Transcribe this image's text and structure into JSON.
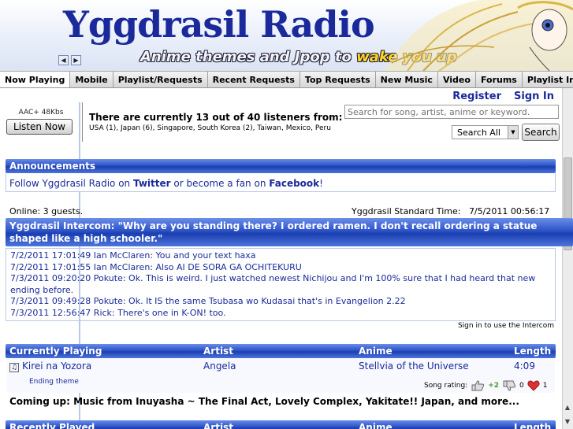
{
  "header": {
    "title": "Yggdrasil Radio",
    "tagline_part1": "Anime themes and Jpop to ",
    "tagline_highlight": "wake you up"
  },
  "tabs": [
    {
      "label": "Now Playing",
      "active": true
    },
    {
      "label": "Mobile"
    },
    {
      "label": "Playlist/Requests"
    },
    {
      "label": "Recent Requests"
    },
    {
      "label": "Top Requests"
    },
    {
      "label": "New Music"
    },
    {
      "label": "Video"
    },
    {
      "label": "Forums"
    },
    {
      "label": "Playlist Info"
    }
  ],
  "account": {
    "register": "Register",
    "signin": "Sign In"
  },
  "player": {
    "bitrate": "AAC+ 48Kbs",
    "listen_label": "Listen Now"
  },
  "listeners": {
    "headline": "There are currently 13 out of 40 listeners from:",
    "countries": "USA (1), Japan (6), Singapore, South Korea (2), Taiwan, Mexico, Peru"
  },
  "search": {
    "placeholder": "Search for song, artist, anime or keyword.",
    "scope": "Search All",
    "button": "Search"
  },
  "announcements": {
    "title": "Announcements",
    "p1": "Follow Yggdrasil Radio on ",
    "twitter": "Twitter",
    "p2": " or become a fan on ",
    "facebook": "Facebook",
    "p3": "!"
  },
  "status": {
    "online": "Online: 3 guests.",
    "time_label": "Yggdrasil Standard Time:",
    "time_value": "7/5/2011 00:56:17"
  },
  "intercom": {
    "title_line1": "Yggdrasil Intercom: \"Why are you standing there? I ordered ramen. I don't recall ordering a statue",
    "title_line2": "shaped like a high schooler.\"",
    "messages": [
      "7/2/2011 17:01:49 Ian McClaren: You and your text haxa",
      "7/2/2011 17:01:55 Ian McClaren: Also AI DE SORA GA OCHITEKURU",
      "7/3/2011 09:20:20 Pokute: Ok. This is weird. I just watched newest Nichijou and I'm 100% sure that I had heard that new",
      "ending before.",
      "7/3/2011 09:49:28 Pokute: Ok. It IS the same Tsubasa wo Kudasai that's in Evangelion 2.22",
      "7/3/2011 12:56:47 Rick: There's one in K-ON! too."
    ],
    "signin_note": "Sign in to use the Intercom"
  },
  "current": {
    "headers": [
      "Currently Playing",
      "Artist",
      "Anime",
      "Length"
    ],
    "song": "Kirei na Yozora",
    "artist": "Angela",
    "anime": "Stellvia of the Universe",
    "length": "4:09",
    "note": "Ending theme",
    "rating_label": "Song rating:",
    "up": "+2",
    "down": "0",
    "fav": "1"
  },
  "coming_up": "Coming up: Music from Inuyasha ~ The Final Act,  Lovely Complex,  Yakitate!! Japan,  and more...",
  "recent": {
    "headers": [
      "Recently Played",
      "Artist",
      "Anime",
      "Length"
    ]
  }
}
